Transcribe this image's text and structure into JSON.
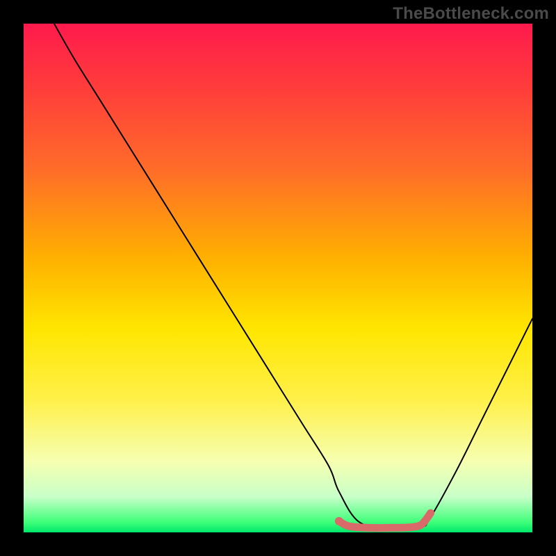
{
  "watermark": "TheBottleneck.com",
  "chart_data": {
    "type": "line",
    "title": "",
    "xlabel": "",
    "ylabel": "",
    "xlim": [
      0,
      100
    ],
    "ylim": [
      0,
      100
    ],
    "grid": false,
    "series": [
      {
        "name": "bottleneck-curve",
        "x": [
          6,
          10,
          15,
          20,
          25,
          30,
          35,
          40,
          45,
          50,
          55,
          60,
          62,
          66,
          72,
          78,
          80,
          85,
          90,
          95,
          100
        ],
        "y": [
          100,
          93,
          85,
          77,
          69,
          61,
          53,
          45,
          37,
          29,
          21,
          13,
          8,
          2,
          1,
          1,
          3,
          12,
          22,
          32,
          42
        ],
        "color": "#000000",
        "width": 2
      },
      {
        "name": "optimal-range-marker",
        "x": [
          62,
          64,
          68,
          72,
          76,
          78,
          79,
          80
        ],
        "y": [
          2.2,
          1.2,
          0.9,
          0.9,
          1.0,
          1.4,
          2.4,
          3.8
        ],
        "color": "#d86a6a",
        "width": 11
      }
    ],
    "points": [
      {
        "name": "optimal-start-dot",
        "x": 62,
        "y": 2.2,
        "r": 6,
        "color": "#d86a6a"
      }
    ]
  }
}
